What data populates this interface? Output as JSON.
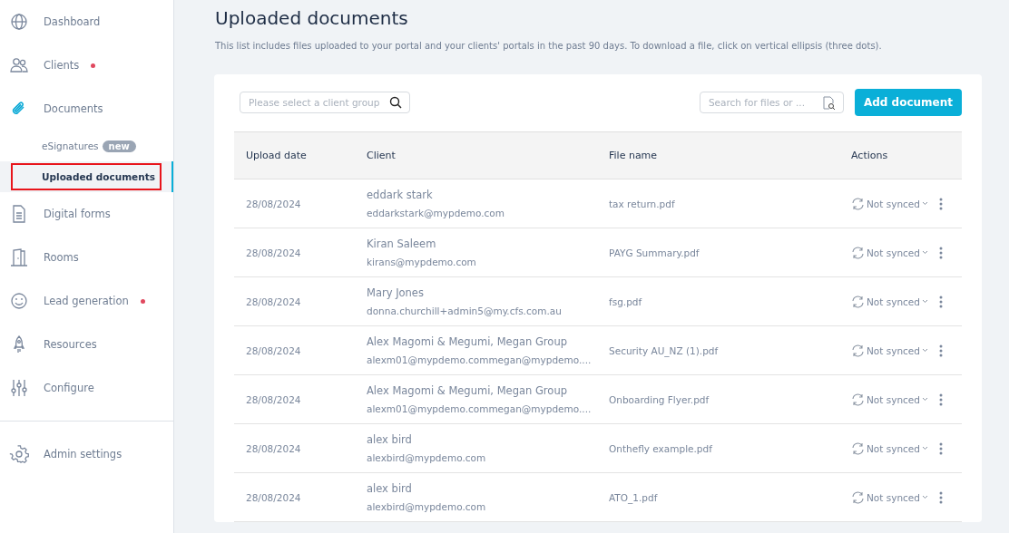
{
  "sidebar": {
    "items": [
      {
        "label": "Dashboard",
        "alert": false,
        "selected": false
      },
      {
        "label": "Clients",
        "alert": true,
        "selected": false
      },
      {
        "label": "Documents",
        "alert": false,
        "selected": false,
        "children": [
          {
            "label": "eSignatures",
            "badge": "new",
            "selected": false
          },
          {
            "label": "Uploaded documents",
            "selected": true
          }
        ]
      },
      {
        "label": "Digital forms",
        "alert": false,
        "selected": false
      },
      {
        "label": "Rooms",
        "alert": false,
        "selected": false
      },
      {
        "label": "Lead generation",
        "alert": true,
        "selected": false
      },
      {
        "label": "Resources",
        "alert": false,
        "selected": false
      },
      {
        "label": "Configure",
        "alert": false,
        "selected": false
      }
    ],
    "footer": {
      "label": "Admin settings"
    }
  },
  "page": {
    "title": "Uploaded documents",
    "description": "This list includes files uploaded to your portal and your clients' portals in the past 90 days. To download a file, click on vertical ellipsis (three dots)."
  },
  "toolbar": {
    "group_filter": {
      "placeholder": "Please select a client group"
    },
    "search": {
      "placeholder": "Search for files or ..."
    },
    "add_button": "Add document"
  },
  "table": {
    "columns": [
      "Upload date",
      "Client",
      "File name",
      "Actions"
    ],
    "rows": [
      {
        "date": "28/08/2024",
        "client": "eddark stark",
        "email": "eddarkstark@mypdemo.com",
        "file": "tax return.pdf",
        "sync": "Not synced"
      },
      {
        "date": "28/08/2024",
        "client": "Kiran Saleem",
        "email": "kirans@mypdemo.com",
        "file": "PAYG Summary.pdf",
        "sync": "Not synced"
      },
      {
        "date": "28/08/2024",
        "client": "Mary Jones",
        "email": "donna.churchill+admin5@my.cfs.com.au",
        "file": "fsg.pdf",
        "sync": "Not synced"
      },
      {
        "date": "28/08/2024",
        "client": "Alex Magomi & Megumi, Megan Group",
        "email": "alexm01@mypdemo.commegan@mypdemo....",
        "file": "Security AU_NZ (1).pdf",
        "sync": "Not synced"
      },
      {
        "date": "28/08/2024",
        "client": "Alex Magomi & Megumi, Megan Group",
        "email": "alexm01@mypdemo.commegan@mypdemo....",
        "file": "Onboarding Flyer.pdf",
        "sync": "Not synced"
      },
      {
        "date": "28/08/2024",
        "client": "alex bird",
        "email": "alexbird@mypdemo.com",
        "file": "Onthefly example.pdf",
        "sync": "Not synced"
      },
      {
        "date": "28/08/2024",
        "client": "alex bird",
        "email": "alexbird@mypdemo.com",
        "file": "ATO_1.pdf",
        "sync": "Not synced"
      }
    ]
  }
}
